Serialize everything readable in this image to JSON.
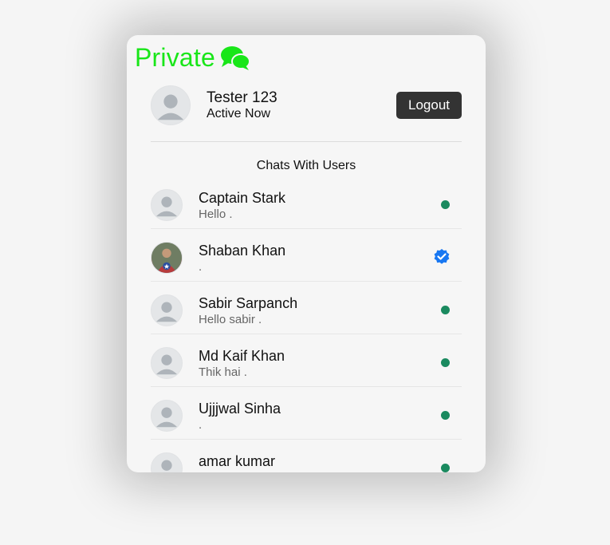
{
  "app": {
    "brand": "Private",
    "brand_color": "#19e619"
  },
  "user": {
    "name": "Tester 123",
    "status": "Active Now",
    "logout_label": "Logout"
  },
  "section_title": "Chats With Users",
  "chats": [
    {
      "name": "Captain Stark",
      "message": "Hello .",
      "indicator": "online-dot"
    },
    {
      "name": "Shaban Khan",
      "message": ".",
      "indicator": "verified-icon"
    },
    {
      "name": "Sabir Sarpanch",
      "message": "Hello sabir .",
      "indicator": "online-dot"
    },
    {
      "name": "Md Kaif Khan",
      "message": "Thik hai .",
      "indicator": "online-dot"
    },
    {
      "name": "Ujjjwal Sinha",
      "message": ".",
      "indicator": "online-dot"
    },
    {
      "name": "amar kumar",
      "message": "",
      "indicator": "online-dot"
    }
  ],
  "colors": {
    "online": "#1a8a5f",
    "verified": "#1877f2",
    "logout_bg": "#333333"
  }
}
